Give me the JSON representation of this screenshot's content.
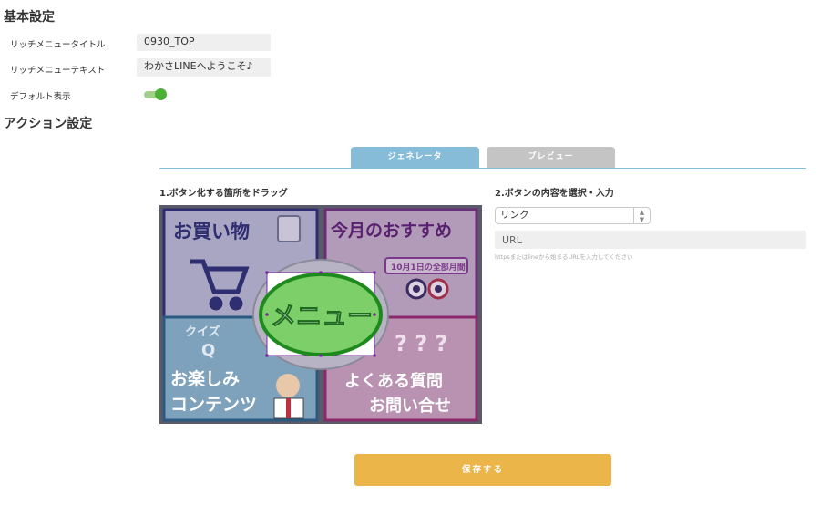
{
  "basic": {
    "heading": "基本設定",
    "title_label": "リッチメニュータイトル",
    "title_value": "0930_TOP",
    "text_label": "リッチメニューテキスト",
    "text_value": "わかさLINEへようこそ♪",
    "default_label": "デフォルト表示",
    "default_on": true
  },
  "action": {
    "heading": "アクション設定",
    "tabs": [
      "ジェネレータ",
      "プレビュー"
    ],
    "left_title": "1.ボタン化する箇所をドラッグ",
    "right_title": "2.ボタンの内容を選択・入力",
    "select_value": "リンク",
    "url_placeholder": "URL",
    "url_hint": "httpsまたはlineから始まるURLを入力してください",
    "save_label": "保存する"
  },
  "rich_menu": {
    "cells": [
      {
        "text": "お買い物",
        "color": "#3a3a8a"
      },
      {
        "text": "今月のおすすめ",
        "color": "#7a3a8a"
      },
      {
        "text": "10月1日の全部月間",
        "color": "#7a3a8a"
      },
      {
        "text": "クイズ",
        "color": "#3a7aaa"
      },
      {
        "text": "Q",
        "color": "#3a7aaa"
      },
      {
        "text": "お楽しみ",
        "color": "#3a7aaa"
      },
      {
        "text": "コンテンツ",
        "color": "#3a7aaa"
      },
      {
        "text": "よくある質問",
        "color": "#a83a7a"
      },
      {
        "text": "お問い合せ",
        "color": "#a83a7a"
      }
    ],
    "center_text": "メニュー"
  },
  "colors": {
    "accent_blue": "#86bcd8",
    "save_orange": "#ebb54a",
    "toggle_green": "#4caf36"
  }
}
